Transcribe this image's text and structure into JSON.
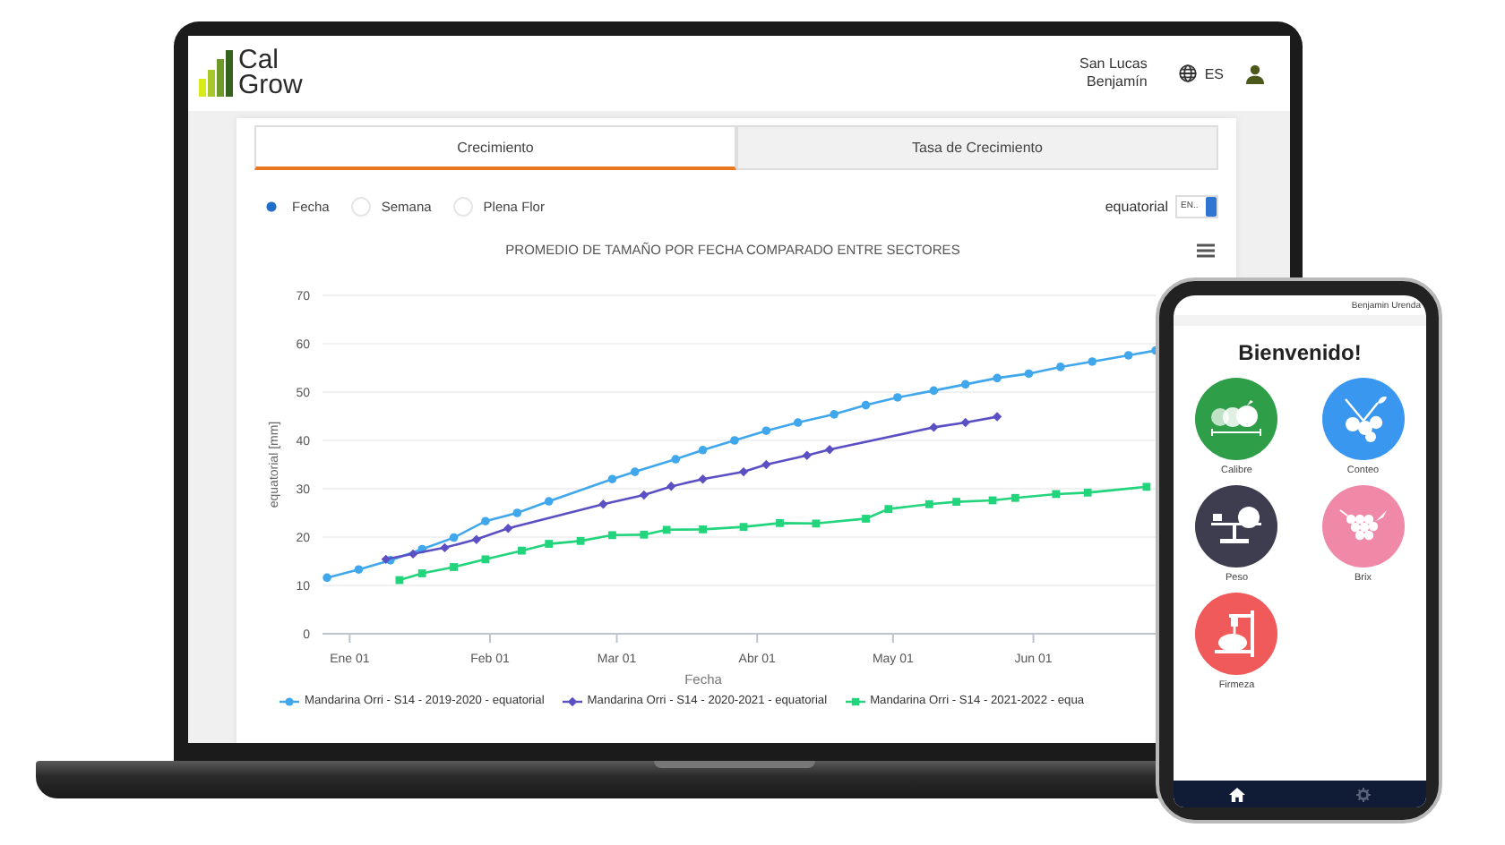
{
  "header": {
    "logo": "Cal Grow",
    "company": "San Lucas",
    "user": "Benjamín",
    "language": "ES"
  },
  "tabs": [
    {
      "label": "Crecimiento",
      "selected": true
    },
    {
      "label": "Tasa de Crecimiento",
      "selected": false
    }
  ],
  "group_by": [
    {
      "label": "Fecha",
      "selected": true
    },
    {
      "label": "Semana",
      "selected": false
    },
    {
      "label": "Plena Flor",
      "selected": false
    }
  ],
  "measure": {
    "label": "equatorial",
    "value": "EN.."
  },
  "chart": {
    "chart_data": {
      "type": "line",
      "title": "PROMEDIO DE TAMAÑO POR FECHA COMPARADO ENTRE SECTORES",
      "xlabel": "Fecha",
      "ylabel": "equatorial [mm]",
      "ylim": [
        0,
        70
      ],
      "grid": true,
      "legend": "bottom",
      "yticks": [
        0,
        10,
        20,
        30,
        40,
        50,
        60,
        70
      ],
      "categories": [
        null,
        null,
        null,
        null,
        null,
        null,
        "Ene 01",
        null,
        null,
        null,
        null,
        null,
        null,
        null,
        null,
        null,
        null,
        null,
        null,
        null,
        null,
        null,
        null,
        null,
        null,
        null,
        null,
        null,
        null,
        null,
        null,
        null,
        null,
        null,
        null,
        null,
        null,
        "Feb 01",
        null,
        null,
        null,
        null,
        null,
        null,
        null,
        null,
        null,
        null,
        null,
        null,
        null,
        null,
        null,
        null,
        null,
        null,
        null,
        null,
        null,
        null,
        null,
        null,
        null,
        null,
        null,
        "Mar 01",
        null,
        null,
        null,
        null,
        null,
        null,
        null,
        null,
        null,
        null,
        null,
        null,
        null,
        null,
        null,
        null,
        null,
        null,
        null,
        null,
        null,
        null,
        null,
        null,
        null,
        null,
        null,
        null,
        null,
        null,
        "Abr 01",
        null,
        null,
        null,
        null,
        null,
        null,
        null,
        null,
        null,
        null,
        null,
        null,
        null,
        null,
        null,
        null,
        null,
        null,
        null,
        null,
        null,
        null,
        null,
        null,
        null,
        null,
        null,
        null,
        null,
        "May 01",
        null,
        null,
        null,
        null,
        null,
        null,
        null,
        null,
        null,
        null,
        null,
        null,
        null,
        null,
        null,
        null,
        null,
        null,
        null,
        null,
        null,
        null,
        null,
        null,
        null,
        null,
        null,
        null,
        null,
        null,
        "Jun 01",
        null,
        null,
        null,
        null,
        null,
        null,
        null,
        null,
        null,
        null,
        null,
        null,
        null,
        null,
        null,
        null,
        null,
        null,
        null,
        null,
        null,
        null,
        null,
        null,
        null,
        null,
        null
      ],
      "series": [
        {
          "name": "Mandarina Orri - S14 - 2019-2020 - equatorial",
          "color": "#41a7ec",
          "marker": "circle",
          "values": [
            null,
            11.6,
            null,
            null,
            null,
            null,
            null,
            null,
            13.3,
            null,
            null,
            null,
            null,
            null,
            null,
            15.2,
            null,
            null,
            null,
            null,
            null,
            null,
            17.5,
            null,
            null,
            null,
            null,
            null,
            null,
            19.9,
            null,
            null,
            null,
            null,
            null,
            null,
            23.3,
            null,
            null,
            null,
            null,
            null,
            null,
            25.0,
            null,
            null,
            null,
            null,
            null,
            null,
            27.4,
            null,
            null,
            null,
            null,
            null,
            null,
            null,
            null,
            null,
            null,
            null,
            null,
            null,
            32.0,
            null,
            null,
            null,
            null,
            33.5,
            null,
            null,
            null,
            null,
            null,
            null,
            null,
            null,
            36.1,
            null,
            null,
            null,
            null,
            null,
            38.0,
            null,
            null,
            null,
            null,
            null,
            null,
            40.0,
            null,
            null,
            null,
            null,
            null,
            null,
            42.0,
            null,
            null,
            null,
            null,
            null,
            null,
            43.7,
            null,
            null,
            null,
            null,
            null,
            null,
            null,
            45.4,
            null,
            null,
            null,
            null,
            null,
            null,
            47.3,
            null,
            null,
            null,
            null,
            null,
            null,
            48.9,
            null,
            null,
            null,
            null,
            null,
            null,
            null,
            50.3,
            null,
            null,
            null,
            null,
            null,
            null,
            51.6,
            null,
            null,
            null,
            null,
            null,
            null,
            52.9,
            null,
            null,
            null,
            null,
            null,
            null,
            53.8,
            null,
            null,
            null,
            null,
            null,
            null,
            55.2,
            null,
            null,
            null,
            null,
            null,
            null,
            56.3,
            null,
            null,
            null,
            null,
            null,
            null,
            null,
            57.6,
            null,
            null,
            null,
            null,
            null,
            58.6
          ]
        },
        {
          "name": "Mandarina Orri - S14 - 2020-2021 - equatorial",
          "color": "#5b4fc4",
          "marker": "diamond",
          "values": [
            null,
            null,
            null,
            null,
            null,
            null,
            null,
            null,
            null,
            null,
            null,
            null,
            null,
            null,
            15.4,
            null,
            null,
            null,
            null,
            null,
            16.5,
            null,
            null,
            null,
            null,
            null,
            null,
            17.8,
            null,
            null,
            null,
            null,
            null,
            null,
            19.5,
            null,
            null,
            null,
            null,
            null,
            null,
            21.8,
            null,
            null,
            null,
            null,
            null,
            null,
            null,
            null,
            null,
            null,
            null,
            null,
            null,
            null,
            null,
            null,
            null,
            null,
            null,
            null,
            26.8,
            null,
            null,
            null,
            null,
            null,
            null,
            null,
            null,
            28.7,
            null,
            null,
            null,
            null,
            null,
            30.5,
            null,
            null,
            null,
            null,
            null,
            null,
            32.0,
            null,
            null,
            null,
            null,
            null,
            null,
            null,
            null,
            33.5,
            null,
            null,
            null,
            null,
            35.0,
            null,
            null,
            null,
            null,
            null,
            null,
            null,
            null,
            36.9,
            null,
            null,
            null,
            null,
            38.1,
            null,
            null,
            null,
            null,
            null,
            null,
            null,
            null,
            null,
            null,
            null,
            null,
            null,
            null,
            null,
            null,
            null,
            null,
            null,
            null,
            null,
            null,
            42.7,
            null,
            null,
            null,
            null,
            null,
            null,
            43.7,
            null,
            null,
            null,
            null,
            null,
            null,
            44.9,
            null,
            null,
            null,
            null,
            null,
            null,
            null,
            null,
            null,
            null,
            null,
            null,
            null,
            null,
            null,
            null,
            null,
            null,
            null,
            null,
            null,
            null,
            null,
            null,
            null,
            null,
            null,
            null,
            null,
            null,
            null,
            null,
            null,
            null,
            null
          ]
        },
        {
          "name": "Mandarina Orri - S14 - 2021-2022 - equa",
          "color": "#22d47c",
          "marker": "square",
          "values": [
            null,
            null,
            null,
            null,
            null,
            null,
            null,
            null,
            null,
            null,
            null,
            null,
            null,
            null,
            null,
            null,
            null,
            11.1,
            null,
            null,
            null,
            null,
            12.5,
            null,
            null,
            null,
            null,
            null,
            null,
            13.8,
            null,
            null,
            null,
            null,
            null,
            null,
            15.4,
            null,
            null,
            null,
            null,
            null,
            null,
            null,
            17.2,
            null,
            null,
            null,
            null,
            null,
            18.6,
            null,
            null,
            null,
            null,
            null,
            null,
            19.2,
            null,
            null,
            null,
            null,
            null,
            null,
            20.4,
            null,
            null,
            null,
            null,
            null,
            null,
            20.5,
            null,
            null,
            null,
            null,
            21.5,
            null,
            null,
            null,
            null,
            null,
            null,
            null,
            21.6,
            null,
            null,
            null,
            null,
            null,
            null,
            null,
            null,
            22.1,
            null,
            null,
            null,
            null,
            null,
            null,
            null,
            22.9,
            null,
            null,
            null,
            null,
            null,
            null,
            null,
            22.8,
            null,
            null,
            null,
            null,
            null,
            null,
            null,
            null,
            null,
            null,
            23.8,
            null,
            null,
            null,
            null,
            25.8,
            null,
            null,
            null,
            null,
            null,
            null,
            null,
            null,
            26.8,
            null,
            null,
            null,
            null,
            null,
            27.3,
            null,
            null,
            null,
            null,
            null,
            null,
            null,
            27.6,
            null,
            null,
            null,
            null,
            28.1,
            null,
            null,
            null,
            null,
            null,
            null,
            null,
            null,
            28.9,
            null,
            null,
            null,
            null,
            null,
            null,
            29.2,
            null,
            null,
            null,
            null,
            null,
            null,
            null,
            null,
            null,
            null,
            null,
            null,
            30.4,
            null,
            null
          ]
        }
      ]
    }
  },
  "phone": {
    "user": "Benjamin Urenda",
    "title": "Bienvenido!",
    "tiles": [
      {
        "label": "Calibre",
        "color": "#2e9e48"
      },
      {
        "label": "Conteo",
        "color": "#3a97f0"
      },
      {
        "label": "Peso",
        "color": "#3d3d4f"
      },
      {
        "label": "Brix",
        "color": "#f088a8"
      },
      {
        "label": "Firmeza",
        "color": "#f05a5a"
      }
    ]
  }
}
